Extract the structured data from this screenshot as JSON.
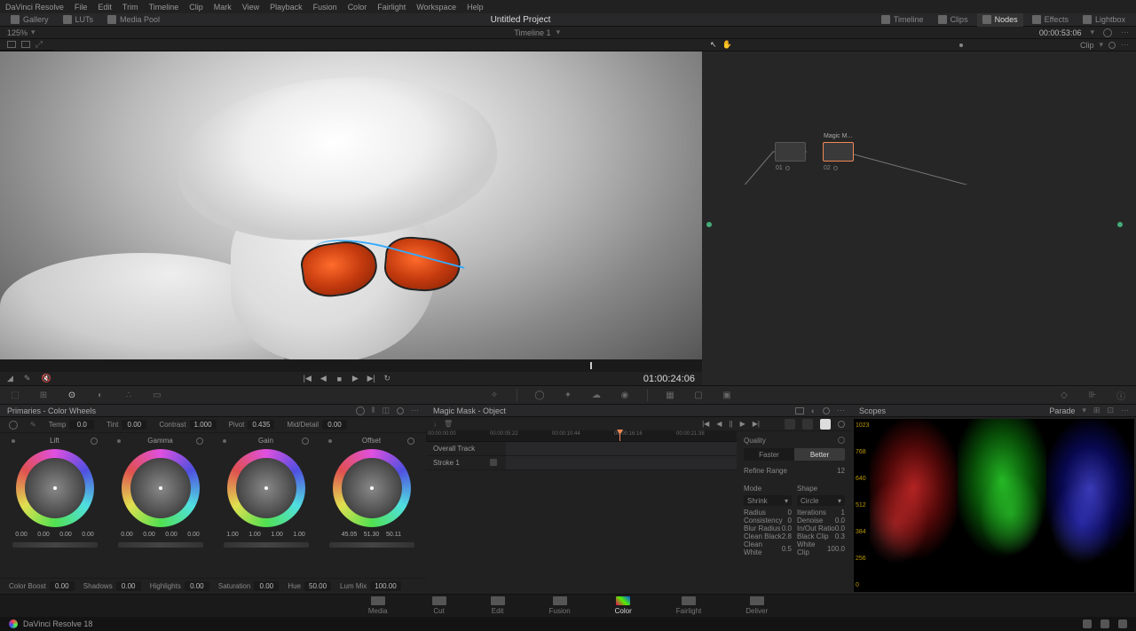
{
  "menu": [
    "DaVinci Resolve",
    "File",
    "Edit",
    "Trim",
    "Timeline",
    "Clip",
    "Mark",
    "View",
    "Playback",
    "Fusion",
    "Color",
    "Fairlight",
    "Workspace",
    "Help"
  ],
  "subbar": {
    "left": [
      {
        "label": "Gallery",
        "icon": "gallery-icon"
      },
      {
        "label": "LUTs",
        "icon": "luts-icon"
      },
      {
        "label": "Media Pool",
        "icon": "media-pool-icon"
      }
    ],
    "center": "Untitled Project",
    "right": [
      {
        "label": "Timeline",
        "icon": "timeline-icon"
      },
      {
        "label": "Clips",
        "icon": "clips-icon"
      },
      {
        "label": "Nodes",
        "icon": "nodes-icon",
        "active": true
      },
      {
        "label": "Effects",
        "icon": "effects-icon"
      },
      {
        "label": "Lightbox",
        "icon": "lightbox-icon"
      }
    ]
  },
  "timelineBar": {
    "zoom": "125%",
    "timeline": "Timeline 1",
    "tc": "00:00:53:06",
    "right": "Clip"
  },
  "transport": {
    "timecode": "01:00:24:06"
  },
  "nodes": {
    "node1": {
      "num": "01"
    },
    "node2": {
      "num": "02",
      "title": "Magic M..."
    }
  },
  "primaries": {
    "title": "Primaries - Color Wheels",
    "row1": [
      {
        "l": "Temp",
        "v": "0.0"
      },
      {
        "l": "Tint",
        "v": "0.00"
      },
      {
        "l": "Contrast",
        "v": "1.000"
      },
      {
        "l": "Pivot",
        "v": "0.435"
      },
      {
        "l": "Mid/Detail",
        "v": "0.00"
      }
    ],
    "wheels": [
      {
        "name": "Lift",
        "vals": [
          "0.00",
          "0.00",
          "0.00",
          "0.00"
        ]
      },
      {
        "name": "Gamma",
        "vals": [
          "0.00",
          "0.00",
          "0.00",
          "0.00"
        ]
      },
      {
        "name": "Gain",
        "vals": [
          "1.00",
          "1.00",
          "1.00",
          "1.00"
        ]
      },
      {
        "name": "Offset",
        "vals": [
          "45.05",
          "51.30",
          "50.11"
        ]
      }
    ],
    "row2": [
      {
        "l": "Color Boost",
        "v": "0.00"
      },
      {
        "l": "Shadows",
        "v": "0.00"
      },
      {
        "l": "Highlights",
        "v": "0.00"
      },
      {
        "l": "Saturation",
        "v": "0.00"
      },
      {
        "l": "Hue",
        "v": "50.00"
      },
      {
        "l": "Lum Mix",
        "v": "100.00"
      }
    ]
  },
  "magicMask": {
    "title": "Magic Mask - Object",
    "timeline": [
      "00:00:00:00",
      "00:00:05:22",
      "00:00:10:44",
      "00:00:16:16",
      "00:00:21:38"
    ],
    "tracks": [
      {
        "name": "Overall Track"
      },
      {
        "name": "Stroke 1"
      }
    ],
    "quality": {
      "label": "Quality",
      "options": [
        "Faster",
        "Better"
      ],
      "selected": "Better"
    },
    "refine": {
      "label": "Refine Range",
      "value": "12"
    },
    "modeShape": {
      "mode": {
        "label": "Mode",
        "value": "Shrink"
      },
      "shape": {
        "label": "Shape",
        "value": "Circle"
      }
    },
    "params": [
      {
        "l1": "Radius",
        "v1": "0",
        "l2": "Iterations",
        "v2": "1"
      },
      {
        "l1": "Consistency",
        "v1": "0",
        "l2": "Denoise",
        "v2": "0.0"
      },
      {
        "l1": "Blur Radius",
        "v1": "0.0",
        "l2": "In/Out Ratio",
        "v2": "0.0"
      },
      {
        "l1": "Clean Black",
        "v1": "2.8",
        "l2": "Black Clip",
        "v2": "0.3"
      },
      {
        "l1": "Clean White",
        "v1": "0.5",
        "l2": "White Clip",
        "v2": "100.0"
      }
    ]
  },
  "scopes": {
    "title": "Scopes",
    "mode": "Parade",
    "yticks": [
      "1023",
      "768",
      "640",
      "512",
      "384",
      "256",
      "0"
    ]
  },
  "pages": [
    "Media",
    "Cut",
    "Edit",
    "Fusion",
    "Color",
    "Fairlight",
    "Deliver"
  ],
  "activePage": "Color",
  "footer": {
    "app": "DaVinci Resolve 18"
  }
}
